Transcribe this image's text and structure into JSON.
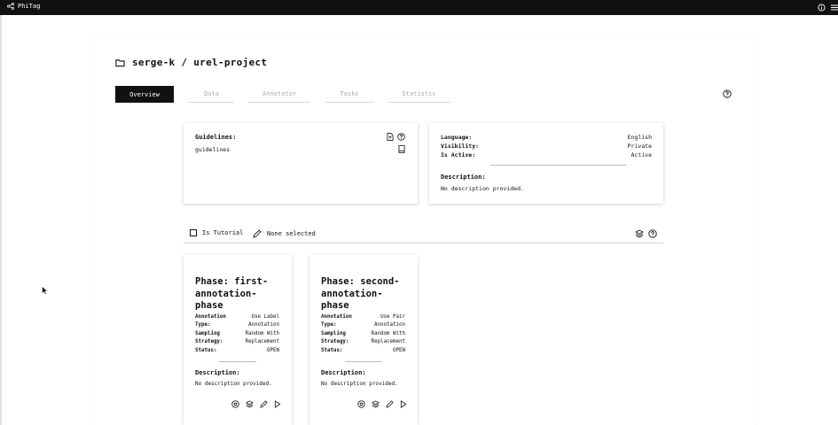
{
  "app": {
    "name": "PhiTag"
  },
  "project": {
    "title": "serge-k / urel-project"
  },
  "tabs": [
    {
      "label": "Overview",
      "active": true
    },
    {
      "label": "Data",
      "active": false
    },
    {
      "label": "Annotator",
      "active": false
    },
    {
      "label": "Tasks",
      "active": false
    },
    {
      "label": "Statistic",
      "active": false
    }
  ],
  "guidelines": {
    "label": "Guidelines:",
    "file": "guidelines"
  },
  "info": {
    "language_label": "Language:",
    "language_value": "English",
    "visibility_label": "Visibility:",
    "visibility_value": "Private",
    "active_label": "Is Active:",
    "active_value": "Active",
    "description_label": "Description:",
    "description_value": "No description provided."
  },
  "toolbar": {
    "tutorial_label": "Is Tutorial",
    "selection_label": "None selected"
  },
  "phases": [
    {
      "title": "Phase: first-annotation-phase",
      "type_label": "Annotation Type:",
      "type_value": "Use Label Annotation",
      "sampling_label": "Sampling Strategy:",
      "sampling_value": "Random With Replacement",
      "status_label": "Status:",
      "status_value": "OPEN",
      "description_label": "Description:",
      "description_value": "No description provided."
    },
    {
      "title": "Phase: second-annotation-phase",
      "type_label": "Annotation Type:",
      "type_value": "Use Pair Annotation",
      "sampling_label": "Sampling Strategy:",
      "sampling_value": "Random With Replacement",
      "status_label": "Status:",
      "status_value": "OPEN",
      "description_label": "Description:",
      "description_value": "No description provided."
    }
  ],
  "icons": [
    "share-icon",
    "info-icon",
    "menu-icon",
    "folder-icon",
    "help-icon",
    "file-icon",
    "book-icon",
    "checkbox-icon",
    "pencil-icon",
    "layers-icon",
    "target-icon",
    "play-icon"
  ]
}
